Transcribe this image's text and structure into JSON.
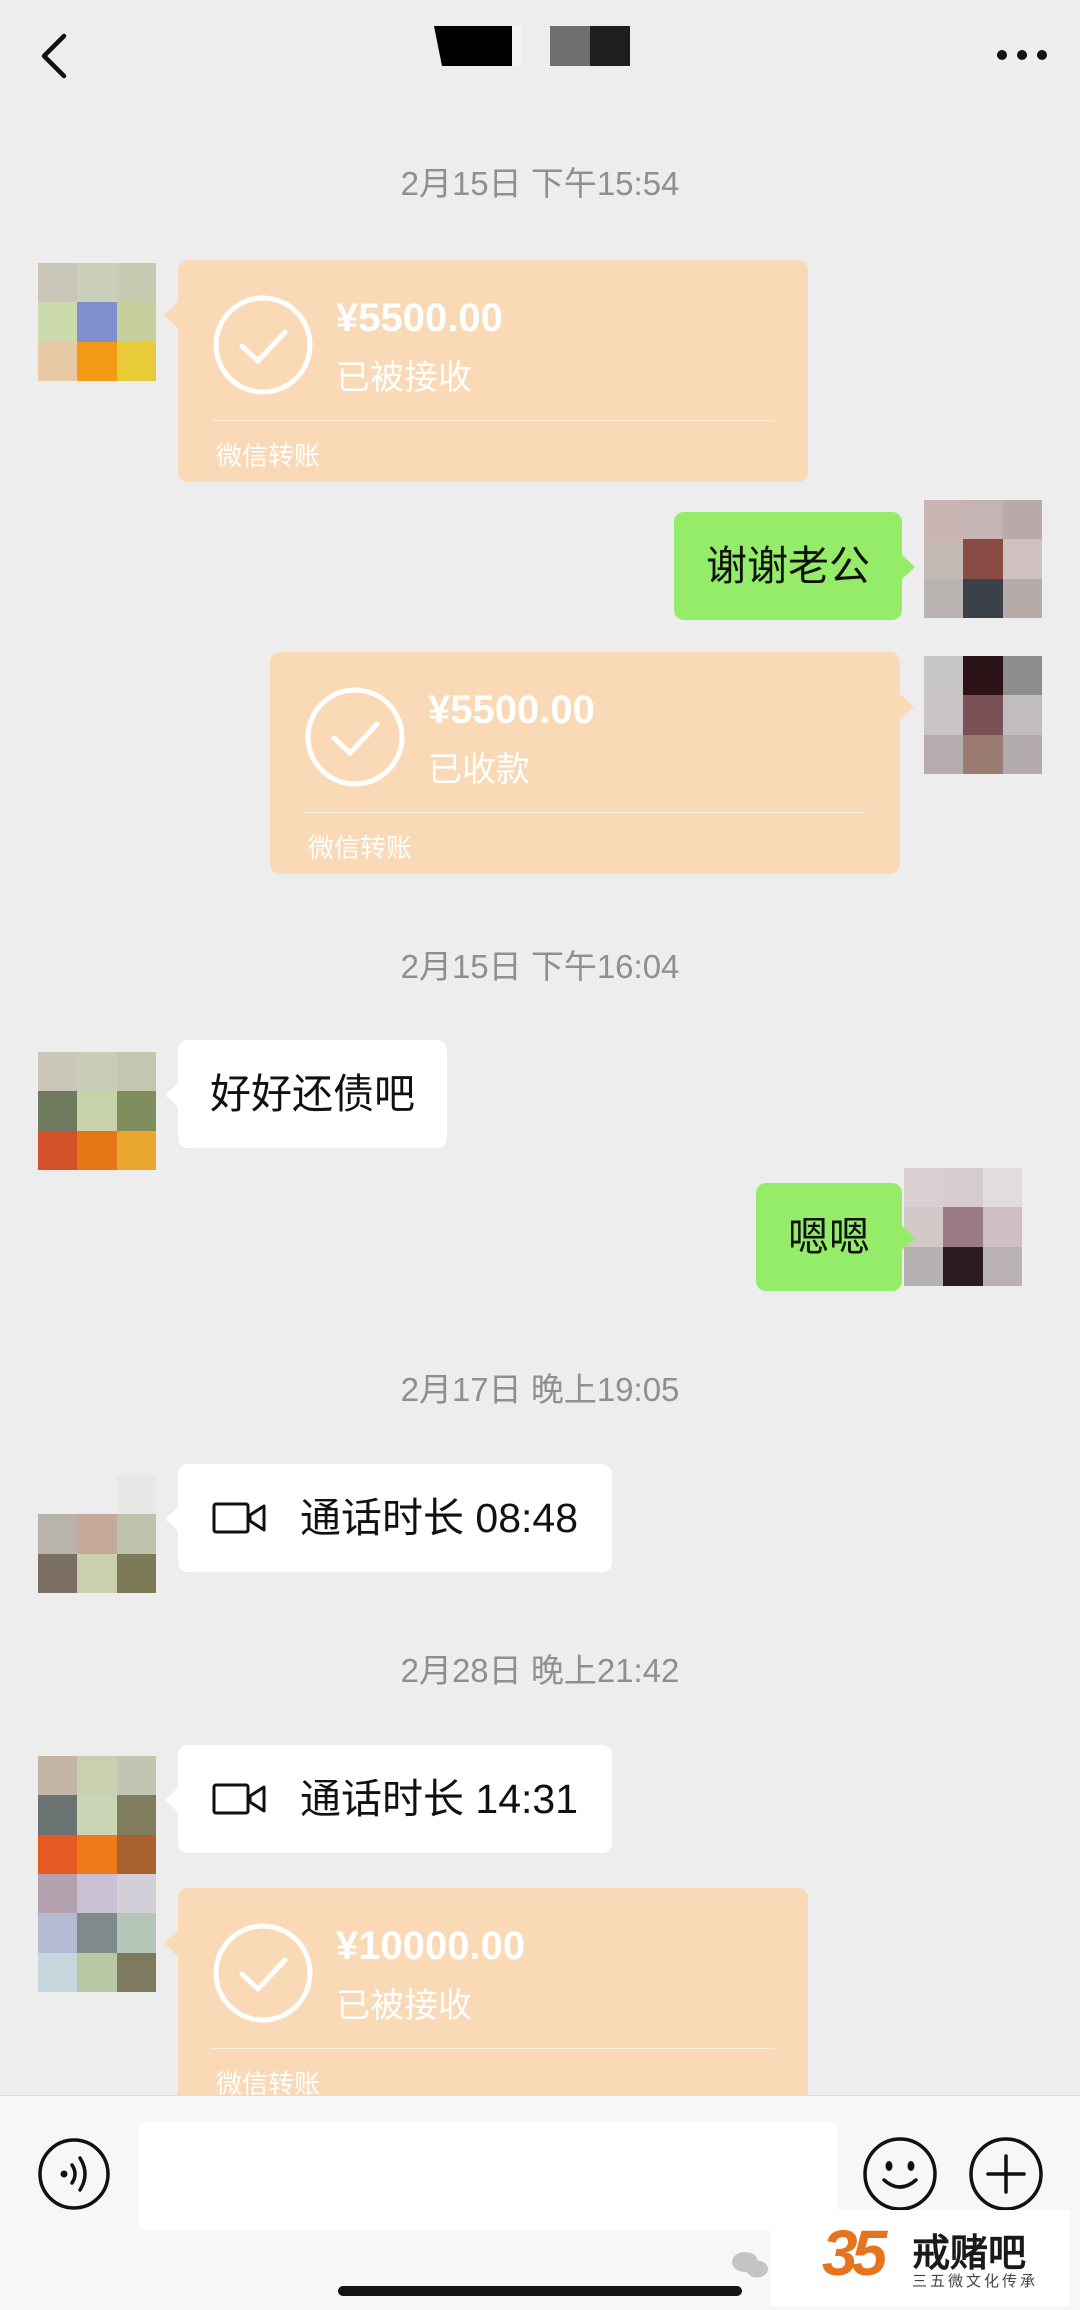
{
  "header": {
    "back_icon": "chevron-left-icon",
    "more_icon": "ellipsis-icon"
  },
  "messages": [
    {
      "type": "timestamp",
      "text": "2月15日 下午15:54"
    },
    {
      "type": "transfer",
      "side": "left",
      "amount": "¥5500.00",
      "status": "已被接收",
      "footer": "微信转账"
    },
    {
      "type": "text",
      "side": "right",
      "text": "谢谢老公"
    },
    {
      "type": "transfer",
      "side": "right",
      "amount": "¥5500.00",
      "status": "已收款",
      "footer": "微信转账"
    },
    {
      "type": "timestamp",
      "text": "2月15日 下午16:04"
    },
    {
      "type": "text",
      "side": "left",
      "text": "好好还债吧"
    },
    {
      "type": "text",
      "side": "right",
      "text": "嗯嗯"
    },
    {
      "type": "timestamp",
      "text": "2月17日 晚上19:05"
    },
    {
      "type": "call",
      "side": "left",
      "text": "通话时长 08:48",
      "icon": "video-call-icon"
    },
    {
      "type": "timestamp",
      "text": "2月28日 晚上21:42"
    },
    {
      "type": "call",
      "side": "left",
      "text": "通话时长 14:31",
      "icon": "video-call-icon"
    },
    {
      "type": "transfer",
      "side": "left",
      "amount": "¥10000.00",
      "status": "已被接收",
      "footer": "微信转账"
    }
  ],
  "input_bar": {
    "voice_icon": "voice-icon",
    "input_value": "",
    "emoji_icon": "emoji-icon",
    "plus_icon": "plus-icon"
  },
  "watermark": {
    "logo": "35",
    "title": "戒赌吧",
    "subtitle": "三五微文化传承"
  },
  "colors": {
    "background": "#ededed",
    "green_bubble": "#95ec69",
    "transfer_bubble": "#f9d9b6",
    "timestamp_text": "#8f8f8f"
  }
}
